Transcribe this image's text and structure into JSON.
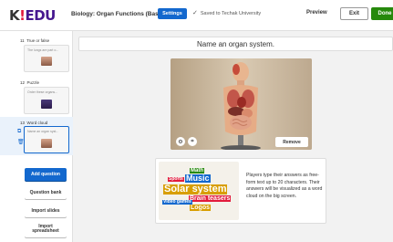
{
  "header": {
    "logo": {
      "k": "K",
      "ex": "!",
      "edu": "EDU"
    },
    "quiz_title": "Biology: Organ Functions (Basic)",
    "settings_label": "Settings",
    "saved_text": "Saved to Techak University",
    "preview_label": "Preview",
    "exit_label": "Exit",
    "done_label": "Done"
  },
  "sidebar": {
    "slides": [
      {
        "number": "11",
        "type": "True or false",
        "thumb_text": "The lungs are part o..."
      },
      {
        "number": "12",
        "type": "Puzzle",
        "thumb_text": "Order these organs..."
      },
      {
        "number": "13",
        "type": "Word cloud",
        "thumb_text": "Name an organ syst..."
      }
    ],
    "buttons": {
      "add_question": "Add question",
      "question_bank": "Question bank",
      "import_slides": "Import slides",
      "import_spreadsheet": "Import spreadsheet"
    }
  },
  "main": {
    "question_text": "Name an organ system.",
    "media": {
      "remove_label": "Remove",
      "icons": [
        "settings-icon",
        "crop-icon"
      ]
    },
    "info_text": "Players type their answers as free-form text up to 20 characters. Their answers will be visualized as a word cloud on the big screen.",
    "word_cloud_words": [
      "Math",
      "Music",
      "Sports",
      "Solar system",
      "Brain teasers",
      "Video games",
      "Logos"
    ]
  },
  "colors": {
    "settings": "#1368ce",
    "done": "#26890c",
    "active_slide": "#1368ce"
  }
}
